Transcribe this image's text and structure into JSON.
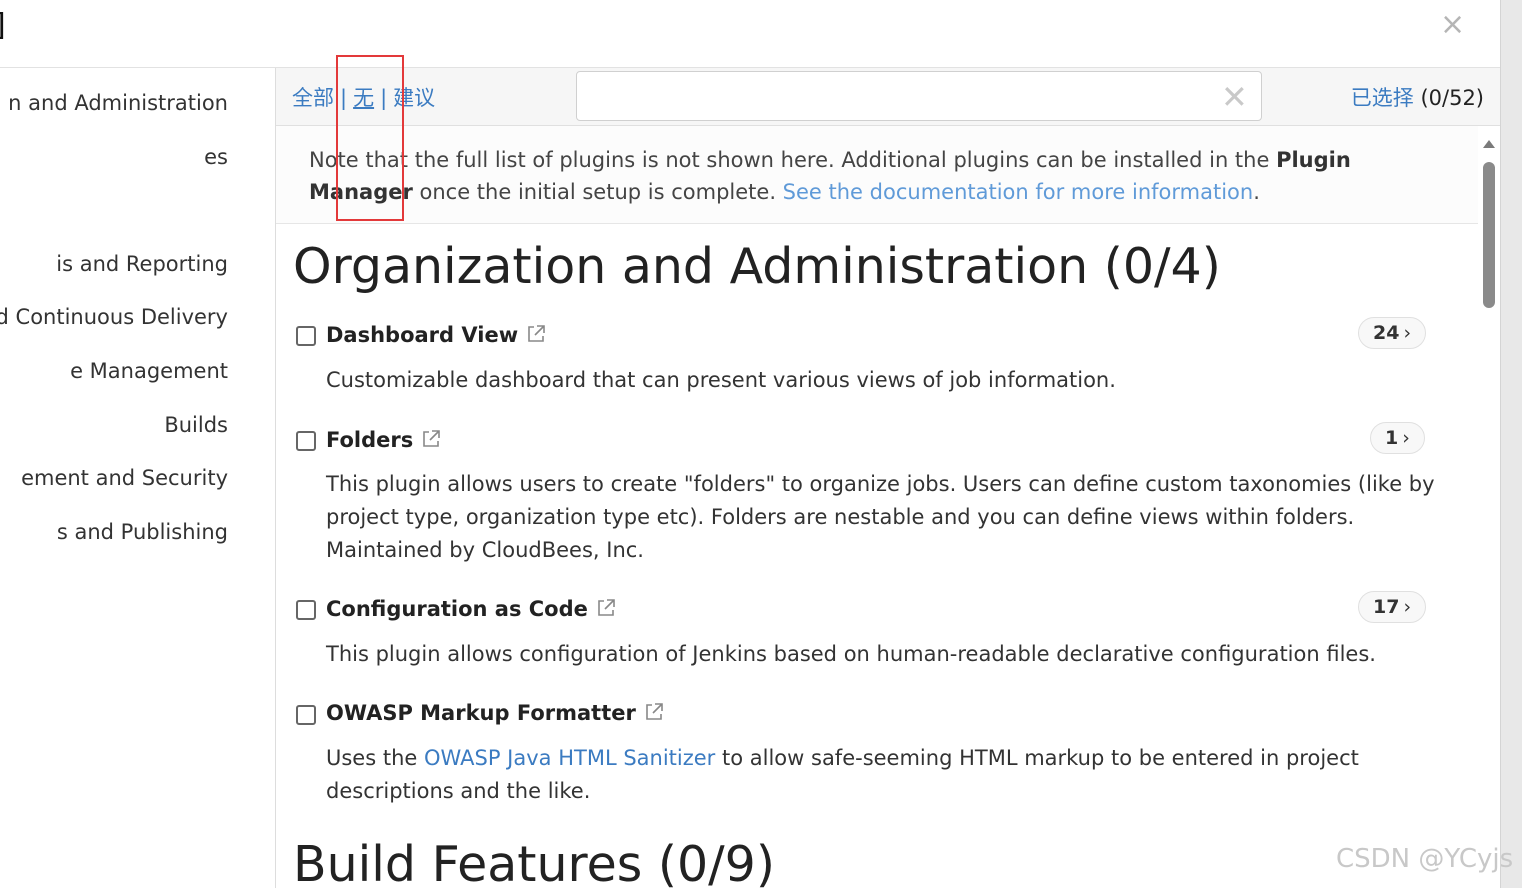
{
  "header": {
    "bracket_glyph": "]",
    "close_glyph": "×"
  },
  "sidebar": {
    "items": [
      {
        "label": "n and Administration"
      },
      {
        "label": "es"
      },
      {
        "label": "is and Reporting"
      },
      {
        "label": "d Continuous Delivery"
      },
      {
        "label": "e Management"
      },
      {
        "label": "Builds"
      },
      {
        "label": "ement and Security"
      },
      {
        "label": "s and Publishing"
      }
    ]
  },
  "toolbar": {
    "filter_all": "全部",
    "filter_none": "无",
    "filter_suggested": "建议",
    "separator": "|",
    "search_value": "",
    "search_clear_glyph": "✕",
    "selected_label": "已选择",
    "selected_count": "(0/52)"
  },
  "note": {
    "text_before": "Note that the full list of plugins is not shown here. Additional plugins can be installed in the ",
    "bold": "Plugin Manager",
    "text_middle": " once the initial setup is complete. ",
    "link": "See the documentation for more information",
    "text_after": "."
  },
  "categories": [
    {
      "title": "Organization and Administration (0/4)",
      "plugins": [
        {
          "name": "Dashboard View",
          "deps": "24",
          "desc": "Customizable dashboard that can present various views of job information."
        },
        {
          "name": "Folders",
          "deps": "1",
          "desc": "This plugin allows users to create \"folders\" to organize jobs. Users can define custom taxonomies (like by project type, organization type etc). Folders are nestable and you can define views within folders. Maintained by CloudBees, Inc."
        },
        {
          "name": "Configuration as Code",
          "deps": "17",
          "desc": "This plugin allows configuration of Jenkins based on human-readable declarative configuration files."
        },
        {
          "name": "OWASP Markup Formatter",
          "desc_before": "Uses the ",
          "desc_link": "OWASP Java HTML Sanitizer",
          "desc_after": " to allow safe-seeming HTML markup to be entered in project descriptions and the like."
        }
      ]
    },
    {
      "title": "Build Features (0/9)"
    }
  ],
  "badge_chevron": "›",
  "watermark": "CSDN @YCyjs",
  "colors": {
    "link": "#3b7bc1",
    "note_link": "#5f9ad8",
    "highlight": "#e3393a"
  }
}
